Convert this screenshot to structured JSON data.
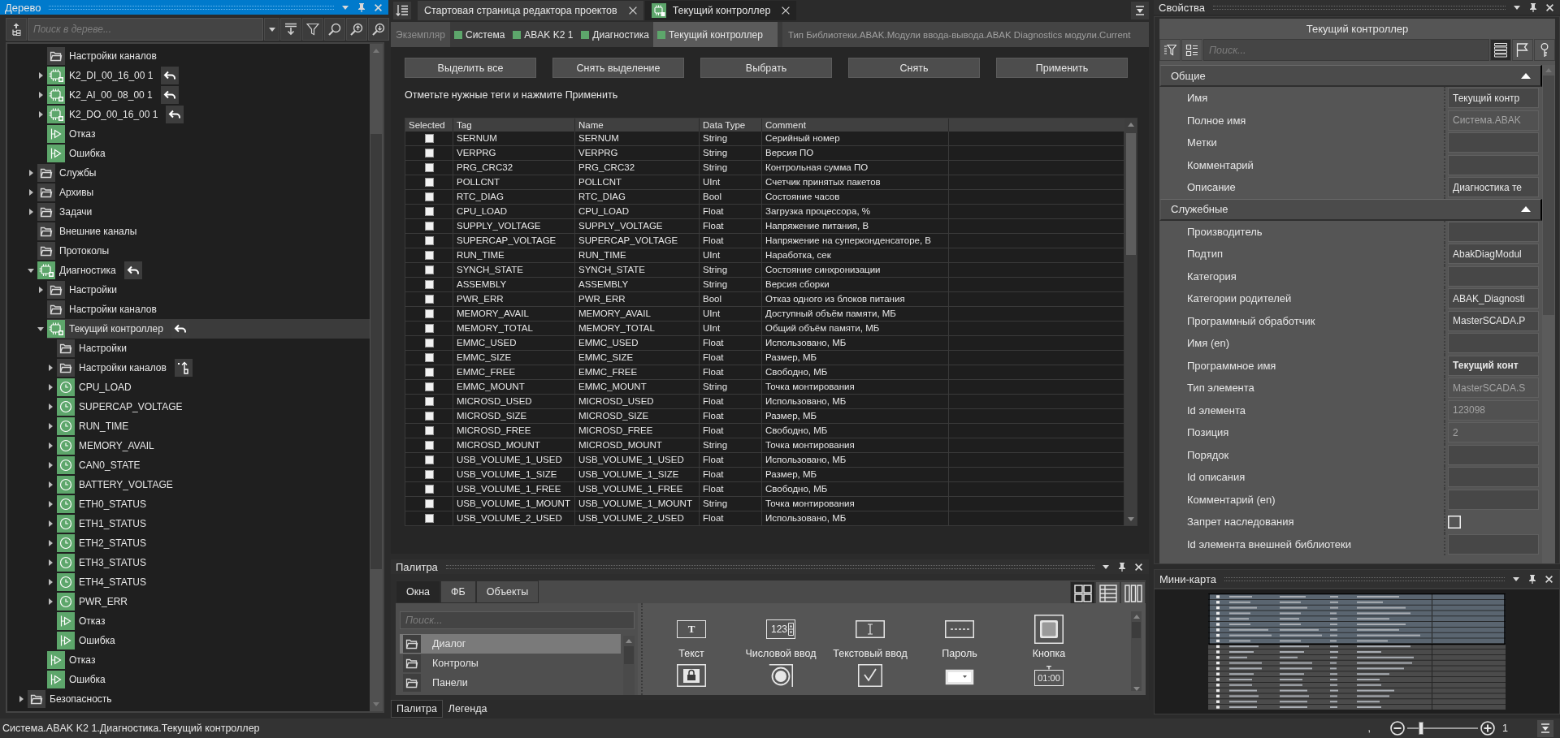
{
  "tree": {
    "title": "Дерево",
    "active": true,
    "search": {
      "placeholder": "Поиск в дереве..."
    },
    "items": [
      {
        "children": [
          {
            "children": [
              {
                "label": "Настройки каналов",
                "kind": "folder",
                "selected": false
              },
              {
                "label": "K2_DI_00_16_00 1",
                "kind": "module",
                "expanded": false,
                "badge": {
                  "kind": "undo"
                },
                "selected": false
              },
              {
                "label": "K2_AI_00_08_00 1",
                "kind": "module",
                "expanded": false,
                "badge": {
                  "kind": "undo"
                },
                "selected": false
              },
              {
                "label": "K2_DO_00_16_00 1",
                "kind": "module",
                "expanded": false,
                "badge": {
                  "kind": "undo"
                },
                "selected": false
              },
              {
                "label": "Отказ",
                "kind": "output",
                "selected": false
              },
              {
                "label": "Ошибка",
                "kind": "output",
                "selected": false
              }
            ]
          },
          {
            "label": "Службы",
            "kind": "folder",
            "expanded": false,
            "selected": false
          },
          {
            "label": "Архивы",
            "kind": "folder",
            "expanded": false,
            "selected": false
          },
          {
            "label": "Задачи",
            "kind": "folder",
            "expanded": false,
            "selected": false
          },
          {
            "label": "Внешние каналы",
            "kind": "folder",
            "selected": false
          },
          {
            "label": "Протоколы",
            "kind": "folder",
            "selected": false
          },
          {
            "label": "Диагностика",
            "kind": "module",
            "expanded": true,
            "badge": {
              "kind": "undo"
            },
            "selected": false,
            "children": [
              {
                "label": "Настройки",
                "kind": "folder",
                "expanded": false,
                "selected": false
              },
              {
                "label": "Настройки каналов",
                "kind": "folder",
                "selected": false
              },
              {
                "label": "Текущий контроллер",
                "kind": "module",
                "expanded": true,
                "badge": {
                  "kind": "undo"
                },
                "selected": true,
                "children": [
                  {
                    "label": "Настройки",
                    "kind": "folder",
                    "selected": false
                  },
                  {
                    "label": "Настройки каналов",
                    "kind": "folder",
                    "expanded": false,
                    "badge": {
                      "kind": "branch"
                    },
                    "selected": false
                  },
                  {
                    "label": "CPU_LOAD",
                    "kind": "tag",
                    "expanded": false,
                    "selected": false
                  },
                  {
                    "label": "SUPERCAP_VOLTAGE",
                    "kind": "tag",
                    "expanded": false,
                    "selected": false
                  },
                  {
                    "label": "RUN_TIME",
                    "kind": "tag",
                    "expanded": false,
                    "selected": false
                  },
                  {
                    "label": "MEMORY_AVAIL",
                    "kind": "tag",
                    "expanded": false,
                    "selected": false
                  },
                  {
                    "label": "CAN0_STATE",
                    "kind": "tag",
                    "expanded": false,
                    "selected": false
                  },
                  {
                    "label": "BATTERY_VOLTAGE",
                    "kind": "tag",
                    "expanded": false,
                    "selected": false
                  },
                  {
                    "label": "ETH0_STATUS",
                    "kind": "tag",
                    "expanded": false,
                    "selected": false
                  },
                  {
                    "label": "ETH1_STATUS",
                    "kind": "tag",
                    "expanded": false,
                    "selected": false
                  },
                  {
                    "label": "ETH2_STATUS",
                    "kind": "tag",
                    "expanded": false,
                    "selected": false
                  },
                  {
                    "label": "ETH3_STATUS",
                    "kind": "tag",
                    "expanded": false,
                    "selected": false
                  },
                  {
                    "label": "ETH4_STATUS",
                    "kind": "tag",
                    "expanded": false,
                    "selected": false
                  },
                  {
                    "label": "PWR_ERR",
                    "kind": "tag",
                    "expanded": false,
                    "selected": false
                  },
                  {
                    "label": "Отказ",
                    "kind": "output",
                    "selected": false
                  },
                  {
                    "label": "Ошибка",
                    "kind": "output",
                    "selected": false
                  }
                ]
              },
              {
                "label": "Отказ",
                "kind": "output",
                "selected": false
              },
              {
                "label": "Ошибка",
                "kind": "output",
                "selected": false
              }
            ]
          }
        ]
      },
      {
        "label": "Безопасность",
        "kind": "folder",
        "expanded": false,
        "selected": false
      }
    ]
  },
  "editor": {
    "tabs": [
      {
        "label": "Стартовая страница редактора проектов",
        "kind": "page",
        "selected": false
      },
      {
        "label": "Текущий контроллер",
        "kind": "module",
        "selected": true
      }
    ],
    "breadcrumb": {
      "label": "Экземпляр",
      "items": [
        {
          "label": "Система",
          "selected": false
        },
        {
          "label": "ABAK K2 1",
          "selected": false
        },
        {
          "label": "Диагностика",
          "selected": false
        },
        {
          "label": "Текущий контроллер",
          "selected": true
        }
      ],
      "type_path": "Тип Библиотеки.ABAK.Модули ввода-вывода.ABAK Diagnostics модули.Current"
    },
    "buttons": [
      "Выделить все",
      "Снять выделение",
      "Выбрать",
      "Снять",
      "Применить"
    ],
    "hint": "Отметьте нужные теги и нажмите Применить",
    "table": {
      "columns": [
        "Selected",
        "Tag",
        "Name",
        "Data Type",
        "Comment"
      ],
      "rows": [
        {
          "checked": false,
          "tag": "SERNUM",
          "name": "SERNUM",
          "data_type": "String",
          "comment": "Серийный номер"
        },
        {
          "checked": false,
          "tag": "VERPRG",
          "name": "VERPRG",
          "data_type": "String",
          "comment": "Версия ПО"
        },
        {
          "checked": false,
          "tag": "PRG_CRC32",
          "name": "PRG_CRC32",
          "data_type": "String",
          "comment": "Контрольная сумма ПО"
        },
        {
          "checked": false,
          "tag": "POLLCNT",
          "name": "POLLCNT",
          "data_type": "UInt",
          "comment": "Счетчик принятых пакетов"
        },
        {
          "checked": false,
          "tag": "RTC_DIAG",
          "name": "RTC_DIAG",
          "data_type": "Bool",
          "comment": "Состояние часов"
        },
        {
          "checked": false,
          "tag": "CPU_LOAD",
          "name": "CPU_LOAD",
          "data_type": "Float",
          "comment": "Загрузка процессора, %"
        },
        {
          "checked": false,
          "tag": "SUPPLY_VOLTAGE",
          "name": "SUPPLY_VOLTAGE",
          "data_type": "Float",
          "comment": "Напряжение питания, В"
        },
        {
          "checked": false,
          "tag": "SUPERCAP_VOLTAGE",
          "name": "SUPERCAP_VOLTAGE",
          "data_type": "Float",
          "comment": "Напряжение на суперконденсаторе, В"
        },
        {
          "checked": false,
          "tag": "RUN_TIME",
          "name": "RUN_TIME",
          "data_type": "UInt",
          "comment": "Наработка, сек"
        },
        {
          "checked": false,
          "tag": "SYNCH_STATE",
          "name": "SYNCH_STATE",
          "data_type": "String",
          "comment": "Состояние синхронизации"
        },
        {
          "checked": false,
          "tag": "ASSEMBLY",
          "name": "ASSEMBLY",
          "data_type": "String",
          "comment": "Версия сборки"
        },
        {
          "checked": false,
          "tag": "PWR_ERR",
          "name": "PWR_ERR",
          "data_type": "Bool",
          "comment": "Отказ одного из блоков питания"
        },
        {
          "checked": false,
          "tag": "MEMORY_AVAIL",
          "name": "MEMORY_AVAIL",
          "data_type": "UInt",
          "comment": "Доступный объём памяти, МБ"
        },
        {
          "checked": false,
          "tag": "MEMORY_TOTAL",
          "name": "MEMORY_TOTAL",
          "data_type": "UInt",
          "comment": "Общий объём памяти, МБ"
        },
        {
          "checked": false,
          "tag": "EMMC_USED",
          "name": "EMMC_USED",
          "data_type": "Float",
          "comment": "Использовано, МБ"
        },
        {
          "checked": false,
          "tag": "EMMC_SIZE",
          "name": "EMMC_SIZE",
          "data_type": "Float",
          "comment": "Размер, МБ"
        },
        {
          "checked": false,
          "tag": "EMMC_FREE",
          "name": "EMMC_FREE",
          "data_type": "Float",
          "comment": "Свободно, МБ"
        },
        {
          "checked": false,
          "tag": "EMMC_MOUNT",
          "name": "EMMC_MOUNT",
          "data_type": "String",
          "comment": "Точка монтирования"
        },
        {
          "checked": false,
          "tag": "MICROSD_USED",
          "name": "MICROSD_USED",
          "data_type": "Float",
          "comment": "Использовано, МБ"
        },
        {
          "checked": false,
          "tag": "MICROSD_SIZE",
          "name": "MICROSD_SIZE",
          "data_type": "Float",
          "comment": "Размер, МБ"
        },
        {
          "checked": false,
          "tag": "MICROSD_FREE",
          "name": "MICROSD_FREE",
          "data_type": "Float",
          "comment": "Свободно, МБ"
        },
        {
          "checked": false,
          "tag": "MICROSD_MOUNT",
          "name": "MICROSD_MOUNT",
          "data_type": "String",
          "comment": "Точка монтирования"
        },
        {
          "checked": false,
          "tag": "USB_VOLUME_1_USED",
          "name": "USB_VOLUME_1_USED",
          "data_type": "Float",
          "comment": "Использовано, МБ"
        },
        {
          "checked": false,
          "tag": "USB_VOLUME_1_SIZE",
          "name": "USB_VOLUME_1_SIZE",
          "data_type": "Float",
          "comment": "Размер, МБ"
        },
        {
          "checked": false,
          "tag": "USB_VOLUME_1_FREE",
          "name": "USB_VOLUME_1_FREE",
          "data_type": "Float",
          "comment": "Свободно, МБ"
        },
        {
          "checked": false,
          "tag": "USB_VOLUME_1_MOUNT",
          "name": "USB_VOLUME_1_MOUNT",
          "data_type": "String",
          "comment": "Точка монтирования"
        },
        {
          "checked": false,
          "tag": "USB_VOLUME_2_USED",
          "name": "USB_VOLUME_2_USED",
          "data_type": "Float",
          "comment": "Использовано, МБ"
        }
      ]
    }
  },
  "palette": {
    "title": "Палитра",
    "active": false,
    "tabs": [
      {
        "label": "Окна",
        "selected": true
      },
      {
        "label": "ФБ",
        "selected": false
      },
      {
        "label": "Объекты",
        "selected": false
      }
    ],
    "view_modes": [
      {
        "kind": "grid",
        "selected": true
      },
      {
        "kind": "table",
        "selected": false
      },
      {
        "kind": "columns",
        "selected": false
      }
    ],
    "search": {
      "placeholder": "Поиск..."
    },
    "categories": [
      {
        "label": "Диалог",
        "selected": true
      },
      {
        "label": "Контролы",
        "selected": false
      },
      {
        "label": "Панели",
        "selected": false
      }
    ],
    "items": [
      {
        "kind": "text",
        "glyph": "T",
        "label": "Текст"
      },
      {
        "kind": "numeric",
        "glyph": "123",
        "label": "Числовой ввод"
      },
      {
        "kind": "textinput",
        "label": "Текстовый ввод"
      },
      {
        "kind": "password",
        "label": "Пароль"
      },
      {
        "kind": "button",
        "label": "Кнопка"
      },
      {
        "kind": "lock"
      },
      {
        "kind": "radio"
      },
      {
        "kind": "checkbox"
      },
      {
        "kind": "combo"
      },
      {
        "kind": "timer",
        "glyph": "01:00"
      }
    ],
    "bottom_tabs": [
      {
        "label": "Палитра",
        "selected": true
      },
      {
        "label": "Легенда",
        "selected": false
      }
    ]
  },
  "properties": {
    "title": "Свойства",
    "active": false,
    "header": "Текущий контроллер",
    "search": {
      "placeholder": "Поиск..."
    },
    "view_modes": [
      {
        "kind": "list",
        "selected": true
      },
      {
        "kind": "flag",
        "selected": false
      },
      {
        "kind": "key",
        "selected": false
      }
    ],
    "sections": [
      {
        "title": "Общие",
        "expanded": true,
        "rows": [
          {
            "label": "Имя",
            "kind": "text",
            "value": "Текущий контр",
            "disabled": false,
            "bold": false
          },
          {
            "label": "Полное имя",
            "kind": "text",
            "value": "Система.ABAK",
            "disabled": true,
            "bold": false
          },
          {
            "label": "Метки",
            "kind": "text",
            "disabled": false
          },
          {
            "label": "Комментарий",
            "kind": "text",
            "disabled": false
          },
          {
            "label": "Описание",
            "kind": "text",
            "value": "Диагностика те",
            "disabled": false,
            "bold": false
          }
        ]
      },
      {
        "title": "Служебные",
        "expanded": true,
        "rows": [
          {
            "label": "Производитель",
            "kind": "text",
            "disabled": false
          },
          {
            "label": "Подтип",
            "kind": "text",
            "value": "AbakDiagModul",
            "disabled": false,
            "bold": false
          },
          {
            "label": "Категория",
            "kind": "text",
            "disabled": false
          },
          {
            "label": "Категории родителей",
            "kind": "text",
            "value": "ABAK_Diagnosti",
            "disabled": false,
            "bold": false
          },
          {
            "label": "Программный обработчик",
            "kind": "text",
            "value": "MasterSCADA.P",
            "disabled": false,
            "bold": false
          },
          {
            "label": "Имя (en)",
            "kind": "text",
            "disabled": false
          },
          {
            "label": "Программное имя",
            "kind": "text",
            "value": "Текущий конт",
            "disabled": false,
            "bold": true
          },
          {
            "label": "Тип элемента",
            "kind": "text",
            "value": "MasterSCADA.S",
            "disabled": true,
            "bold": false
          },
          {
            "label": "Id элемента",
            "kind": "text",
            "value": "123098",
            "disabled": true,
            "bold": false
          },
          {
            "label": "Позиция",
            "kind": "text",
            "value": "2",
            "disabled": true,
            "bold": false
          },
          {
            "label": "Порядок",
            "kind": "text",
            "disabled": false
          },
          {
            "label": "Id описания",
            "kind": "text",
            "disabled": false
          },
          {
            "label": "Комментарий (en)",
            "kind": "text",
            "disabled": false
          },
          {
            "label": "Запрет наследования",
            "kind": "checkbox",
            "checked": false,
            "disabled": false
          },
          {
            "label": "Id элемента внешней библиотеки",
            "kind": "text",
            "disabled": false
          }
        ]
      }
    ]
  },
  "minimap": {
    "title": "Мини-карта",
    "active": false
  },
  "status_bar": {
    "path": "Система.ABAK K2 1.Диагностика.Текущий контроллер",
    "mark": ",",
    "zoom": {
      "level": 0.2,
      "value": "1"
    }
  }
}
